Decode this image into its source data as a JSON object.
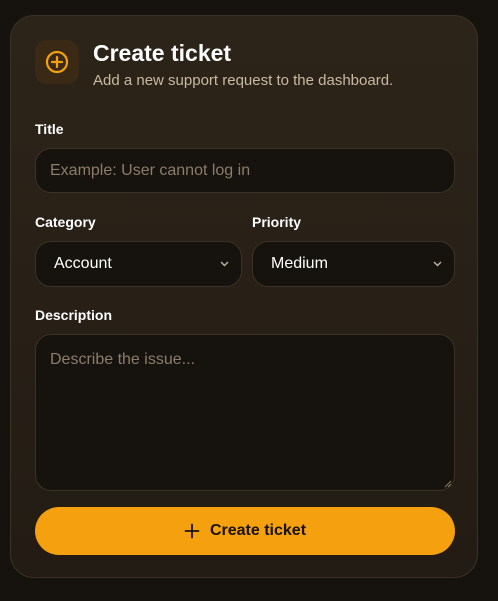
{
  "header": {
    "title": "Create ticket",
    "subtitle": "Add a new support request to the dashboard.",
    "icon": "plus-circle-icon"
  },
  "form": {
    "title_label": "Title",
    "title_placeholder": "Example: User cannot log in",
    "title_value": "",
    "category_label": "Category",
    "category_value": "Account",
    "priority_label": "Priority",
    "priority_value": "Medium",
    "description_label": "Description",
    "description_placeholder": "Describe the issue...",
    "description_value": "",
    "submit_label": "Create ticket",
    "submit_icon": "plus-icon"
  },
  "colors": {
    "accent": "#f4a00f",
    "card_bg": "#2a2118",
    "field_bg": "#16120d",
    "page_bg": "#16120d"
  }
}
